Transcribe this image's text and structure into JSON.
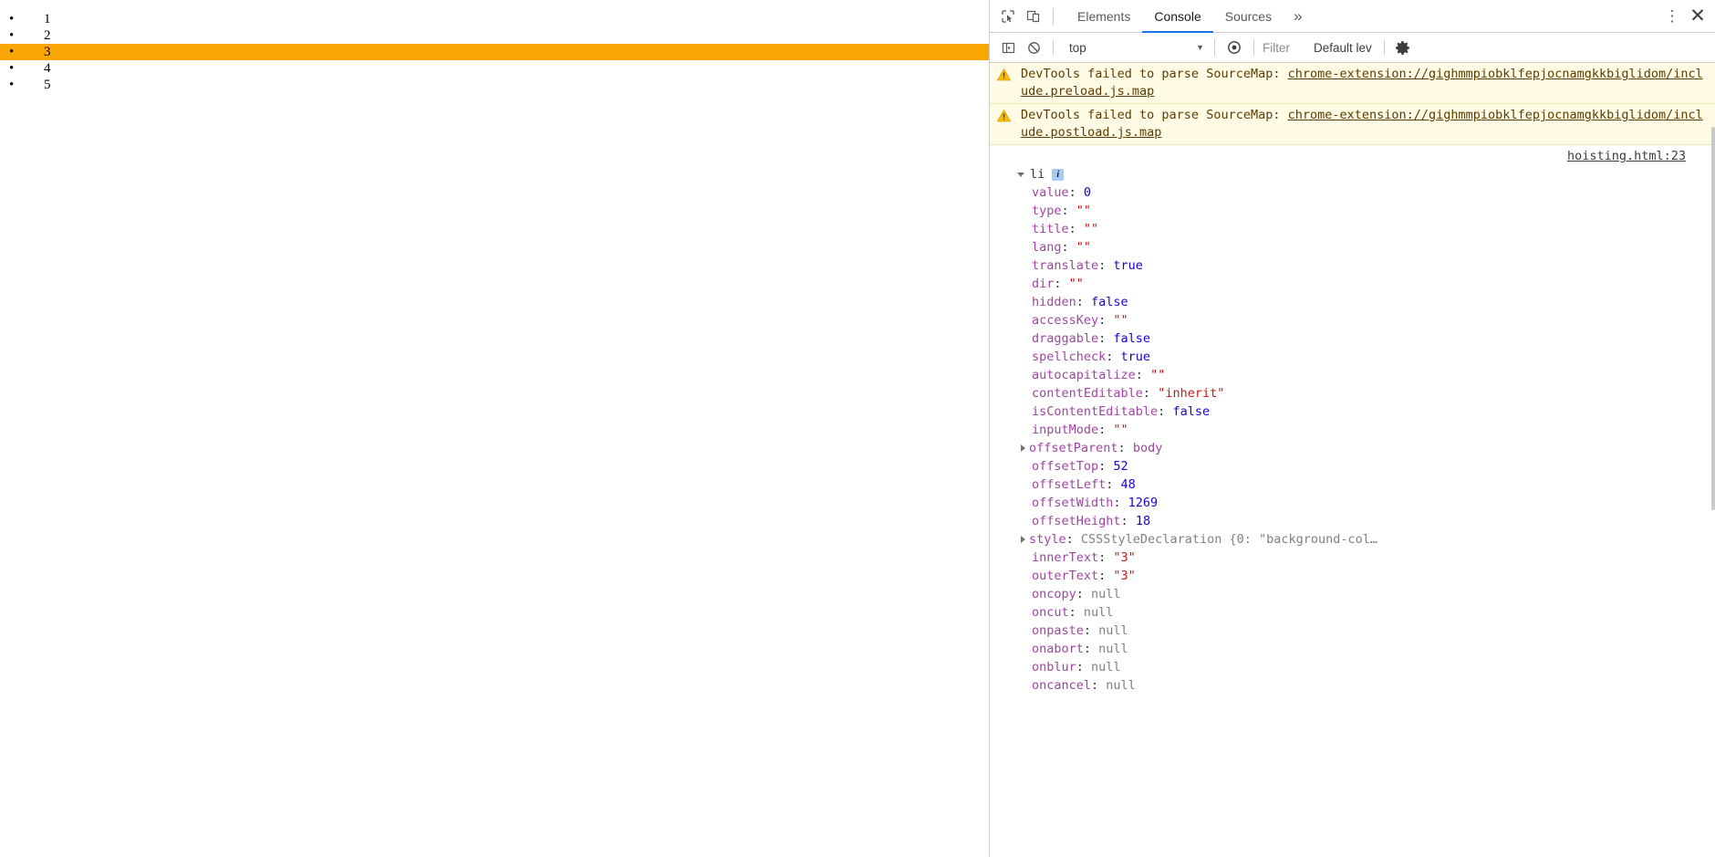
{
  "page": {
    "list_items": [
      "1",
      "2",
      "3",
      "4",
      "5"
    ],
    "highlighted_index": 2,
    "highlight_color": "#f9a602"
  },
  "devtools": {
    "tabs": [
      {
        "label": "Elements",
        "active": false
      },
      {
        "label": "Console",
        "active": true
      },
      {
        "label": "Sources",
        "active": false
      }
    ],
    "more_tabs_label": "»",
    "kebab_label": "⋮",
    "close_label": "✕",
    "inspect_icon": "inspect-element-icon",
    "device_icon": "device-toolbar-icon",
    "console_toolbar": {
      "sidebar_icon": "console-sidebar-icon",
      "clear_icon": "clear-console-icon",
      "context": "top",
      "context_caret": "▼",
      "eye_icon": "live-expression-icon",
      "filter_placeholder": "Filter",
      "filter_value": "",
      "level": "Default lev",
      "gear_icon": "console-settings-icon"
    },
    "messages": [
      {
        "type": "warning",
        "prefix": "DevTools failed to parse SourceMap: ",
        "link": "chrome-extension://gighmmpiobklfepjocnamgkkbiglidom/include.preload.js.map"
      },
      {
        "type": "warning",
        "prefix": "DevTools failed to parse SourceMap: ",
        "link": "chrome-extension://gighmmpiobklfepjocnamgkkbiglidom/include.postload.js.map"
      }
    ],
    "object_log": {
      "source_link": "hoisting.html:23",
      "header_name": "li",
      "info_badge": "i",
      "properties": [
        {
          "name": "value",
          "value": "0",
          "kind": "num",
          "expandable": false
        },
        {
          "name": "type",
          "value": "\"\"",
          "kind": "str",
          "expandable": false
        },
        {
          "name": "title",
          "value": "\"\"",
          "kind": "str",
          "expandable": false
        },
        {
          "name": "lang",
          "value": "\"\"",
          "kind": "str",
          "expandable": false
        },
        {
          "name": "translate",
          "value": "true",
          "kind": "bool",
          "expandable": false
        },
        {
          "name": "dir",
          "value": "\"\"",
          "kind": "str",
          "expandable": false
        },
        {
          "name": "hidden",
          "value": "false",
          "kind": "bool",
          "expandable": false
        },
        {
          "name": "accessKey",
          "value": "\"\"",
          "kind": "str",
          "expandable": false
        },
        {
          "name": "draggable",
          "value": "false",
          "kind": "bool",
          "expandable": false
        },
        {
          "name": "spellcheck",
          "value": "true",
          "kind": "bool",
          "expandable": false
        },
        {
          "name": "autocapitalize",
          "value": "\"\"",
          "kind": "str",
          "expandable": false
        },
        {
          "name": "contentEditable",
          "value": "\"inherit\"",
          "kind": "str",
          "expandable": false
        },
        {
          "name": "isContentEditable",
          "value": "false",
          "kind": "bool",
          "expandable": false
        },
        {
          "name": "inputMode",
          "value": "\"\"",
          "kind": "str",
          "expandable": false
        },
        {
          "name": "offsetParent",
          "value": "body",
          "kind": "node",
          "expandable": true
        },
        {
          "name": "offsetTop",
          "value": "52",
          "kind": "num",
          "expandable": false
        },
        {
          "name": "offsetLeft",
          "value": "48",
          "kind": "num",
          "expandable": false
        },
        {
          "name": "offsetWidth",
          "value": "1269",
          "kind": "num",
          "expandable": false
        },
        {
          "name": "offsetHeight",
          "value": "18",
          "kind": "num",
          "expandable": false
        },
        {
          "name": "style",
          "value": "CSSStyleDeclaration {0: \"background-col…",
          "kind": "cls",
          "expandable": true
        },
        {
          "name": "innerText",
          "value": "\"3\"",
          "kind": "str",
          "expandable": false
        },
        {
          "name": "outerText",
          "value": "\"3\"",
          "kind": "str",
          "expandable": false
        },
        {
          "name": "oncopy",
          "value": "null",
          "kind": "null",
          "expandable": false
        },
        {
          "name": "oncut",
          "value": "null",
          "kind": "null",
          "expandable": false
        },
        {
          "name": "onpaste",
          "value": "null",
          "kind": "null",
          "expandable": false
        },
        {
          "name": "onabort",
          "value": "null",
          "kind": "null",
          "expandable": false
        },
        {
          "name": "onblur",
          "value": "null",
          "kind": "null",
          "expandable": false
        },
        {
          "name": "oncancel",
          "value": "null",
          "kind": "null",
          "expandable": false
        }
      ]
    }
  }
}
